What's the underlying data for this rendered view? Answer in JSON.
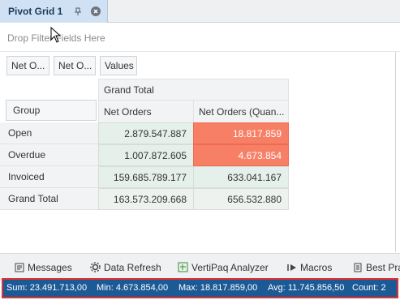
{
  "tab": {
    "title": "Pivot Grid 1"
  },
  "filter_zone": {
    "placeholder": "Drop Filter Fields Here"
  },
  "field_chips": [
    "Net O...",
    "Net O...",
    "Values"
  ],
  "pivot": {
    "grand_total_header": "Grand Total",
    "group_label": "Group",
    "columns": [
      "Net Orders",
      "Net Orders (Quan..."
    ],
    "rows": [
      {
        "label": "Open",
        "values": [
          "2.879.547.887",
          "18.817.859"
        ]
      },
      {
        "label": "Overdue",
        "values": [
          "1.007.872.605",
          "4.673.854"
        ]
      },
      {
        "label": "Invoiced",
        "values": [
          "159.685.789.177",
          "633.041.167"
        ]
      },
      {
        "label": "Grand Total",
        "values": [
          "163.573.209.668",
          "656.532.880"
        ]
      }
    ],
    "highlight_color": "#f77f66"
  },
  "bottom_tabs": [
    "Messages",
    "Data Refresh",
    "VertiPaq Analyzer",
    "Macros",
    "Best Pra"
  ],
  "status": {
    "sum": "Sum: 23.491.713,00",
    "min": "Min: 4.673.854,00",
    "max": "Max: 18.817.859,00",
    "avg": "Avg: 11.745.856,50",
    "count": "Count: 2"
  }
}
